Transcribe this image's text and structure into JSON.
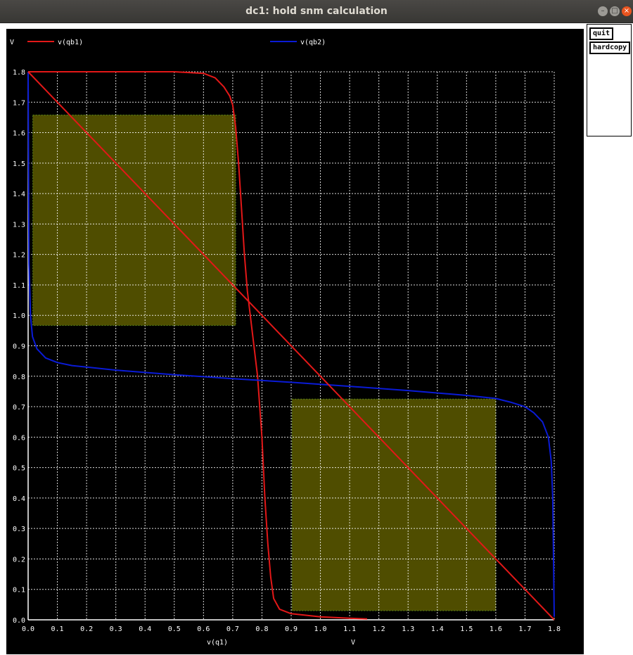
{
  "window": {
    "title": "dc1: hold snm calculation",
    "buttons": {
      "quit": "quit",
      "hardcopy": "hardcopy"
    }
  },
  "colors": {
    "background": "#000000",
    "grid": "#ffffff",
    "series_qb1": "#e31818",
    "series_qb2": "#0a1bd6",
    "snm_box_fill": "#4f4d00",
    "snm_box_border": "#5a8a1a"
  },
  "chart_data": {
    "type": "line",
    "title": "dc1: hold snm calculation",
    "ylabel": "V",
    "xlabel_left": "v(q1)",
    "xlabel_right": "V",
    "xlim": [
      0,
      1.8
    ],
    "ylim": [
      0,
      1.8
    ],
    "grid": true,
    "legend_position": "top",
    "legend": [
      "v(qb1)",
      "v(qb2)"
    ],
    "x_ticks": [
      "0.0",
      "0.1",
      "0.2",
      "0.3",
      "0.4",
      "0.5",
      "0.6",
      "0.7",
      "0.8",
      "0.9",
      "1.0",
      "1.1",
      "1.2",
      "1.3",
      "1.4",
      "1.5",
      "1.6",
      "1.7",
      "1.8"
    ],
    "y_ticks": [
      "0.0",
      "0.1",
      "0.2",
      "0.3",
      "0.4",
      "0.5",
      "0.6",
      "0.7",
      "0.8",
      "0.9",
      "1.0",
      "1.1",
      "1.2",
      "1.3",
      "1.4",
      "1.5",
      "1.6",
      "1.7",
      "1.8"
    ],
    "series": [
      {
        "name": "v(qb1)",
        "color": "#e31818",
        "points": [
          [
            0,
            1.8
          ],
          [
            0.5,
            1.8
          ],
          [
            0.6,
            1.795
          ],
          [
            0.64,
            1.78
          ],
          [
            0.67,
            1.75
          ],
          [
            0.69,
            1.72
          ],
          [
            0.7,
            1.69
          ],
          [
            0.71,
            1.62
          ],
          [
            0.72,
            1.5
          ],
          [
            0.73,
            1.35
          ],
          [
            0.74,
            1.2
          ],
          [
            0.75,
            1.08
          ],
          [
            0.77,
            0.92
          ],
          [
            0.785,
            0.8
          ],
          [
            0.8,
            0.6
          ],
          [
            0.81,
            0.4
          ],
          [
            0.82,
            0.25
          ],
          [
            0.83,
            0.14
          ],
          [
            0.84,
            0.07
          ],
          [
            0.86,
            0.035
          ],
          [
            0.9,
            0.02
          ],
          [
            1.0,
            0.01
          ],
          [
            1.1,
            0.005
          ],
          [
            1.16,
            0.003
          ]
        ]
      },
      {
        "name": "v(qb2)",
        "color": "#0a1bd6",
        "points": [
          [
            0,
            1.8
          ],
          [
            0.003,
            1.17
          ],
          [
            0.008,
            1.0
          ],
          [
            0.015,
            0.93
          ],
          [
            0.03,
            0.89
          ],
          [
            0.06,
            0.86
          ],
          [
            0.1,
            0.845
          ],
          [
            0.15,
            0.835
          ],
          [
            0.3,
            0.82
          ],
          [
            0.5,
            0.805
          ],
          [
            0.7,
            0.792
          ],
          [
            0.9,
            0.78
          ],
          [
            1.1,
            0.767
          ],
          [
            1.3,
            0.753
          ],
          [
            1.5,
            0.737
          ],
          [
            1.6,
            0.727
          ],
          [
            1.65,
            0.715
          ],
          [
            1.7,
            0.7
          ],
          [
            1.73,
            0.68
          ],
          [
            1.76,
            0.65
          ],
          [
            1.78,
            0.6
          ],
          [
            1.79,
            0.52
          ],
          [
            1.795,
            0.4
          ],
          [
            1.8,
            0.01
          ]
        ]
      },
      {
        "name": "",
        "color": "#e31818",
        "points": [
          [
            0,
            1.8
          ],
          [
            1.8,
            0
          ]
        ]
      }
    ],
    "snm_boxes": [
      {
        "x": [
          0.016,
          0.71
        ],
        "y": [
          0.967,
          1.658
        ]
      },
      {
        "x": [
          0.903,
          1.6
        ],
        "y": [
          0.03,
          0.725
        ]
      }
    ]
  }
}
